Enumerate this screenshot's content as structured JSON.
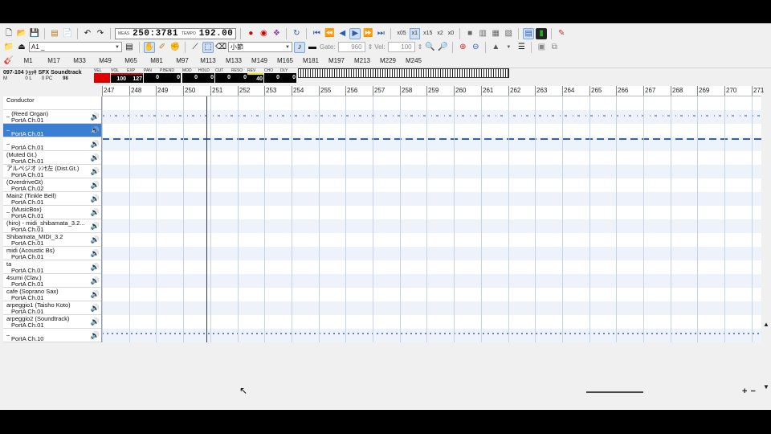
{
  "toolbar_main": {
    "buttons": [
      "new-icon",
      "open-icon",
      "save-icon",
      "export-icon",
      "properties-icon",
      "undo-icon",
      "redo-icon"
    ],
    "meas_label": "MEAS",
    "meas_value": "250:3781",
    "tempo_label": "TEMPO",
    "tempo_value": "192.00",
    "speeds": [
      "x05",
      "x1",
      "x15",
      "x2",
      "x0"
    ],
    "active_speed": "x1"
  },
  "toolbar_edit": {
    "track_combo": "A1 _",
    "snap_combo": "小節",
    "gate_label": "Gate:",
    "gate_value": "960",
    "vel_label": "Vel:",
    "vel_value": "100"
  },
  "marker_tabs": [
    "M1",
    "M17",
    "M33",
    "M49",
    "M65",
    "M81",
    "M97",
    "M113",
    "M133",
    "M149",
    "M165",
    "M181",
    "M197",
    "M213",
    "M229",
    "M245"
  ],
  "status": {
    "song_title": "097-104 ｼｮｯｷ SFX Soundtrack",
    "m_label": "M",
    "m_value": "0",
    "l_label": "L",
    "l_value": "0",
    "pc_label": "PC",
    "pc_value": "98",
    "controllers": [
      {
        "label": "VEL",
        "value": ""
      },
      {
        "label": "VOL",
        "value": "100"
      },
      {
        "label": "EXP",
        "value": "127"
      },
      {
        "label": "PAN",
        "value": "0"
      },
      {
        "label": "P.BEND",
        "value": "0"
      },
      {
        "label": "MOD",
        "value": "0"
      },
      {
        "label": "HOLD",
        "value": "0"
      },
      {
        "label": "CUT",
        "value": "0"
      },
      {
        "label": "RESO",
        "value": "0"
      },
      {
        "label": "REV",
        "value": "40"
      },
      {
        "label": "CHO",
        "value": "0"
      },
      {
        "label": "DLY",
        "value": "0"
      }
    ]
  },
  "ruler": [
    "247",
    "248",
    "249",
    "250",
    "251",
    "252",
    "253",
    "254",
    "255",
    "256",
    "257",
    "258",
    "259",
    "260",
    "261",
    "262",
    "263",
    "264",
    "265",
    "266",
    "267",
    "268",
    "269",
    "270",
    "271"
  ],
  "tracks": [
    {
      "name": "Conductor",
      "port": ""
    },
    {
      "name": "_ (Reed Organ)",
      "port": "PortA  Ch.01"
    },
    {
      "name": "_",
      "port": "PortA  Ch.01"
    },
    {
      "name": "_",
      "port": "PortA  Ch.01"
    },
    {
      "name": " (Muted Gt.)",
      "port": "PortA  Ch.01"
    },
    {
      "name": "アルペジオ ｼﾝｾ左 (Dist.Gt.)",
      "port": "PortA  Ch.01"
    },
    {
      "name": " (OverdriveGt)",
      "port": "PortA  Ch.02"
    },
    {
      "name": "Main2 (Tinkle Bell)",
      "port": "PortA  Ch.01"
    },
    {
      "name": "_ (MusicBox)",
      "port": "PortA  Ch.01"
    },
    {
      "name": " (hiro) - midi_shibamata_3.2...",
      "port": "PortA  Ch.01"
    },
    {
      "name": "Shibamata_MIDI_3.2",
      "port": "PortA  Ch.01"
    },
    {
      "name": "midi (Acoustic Bs)",
      "port": "PortA  Ch.01"
    },
    {
      "name": "ta",
      "port": "PortA  Ch.01"
    },
    {
      "name": "4sumi (Clav.)",
      "port": "PortA  Ch.01"
    },
    {
      "name": "cafe (Soprano Sax)",
      "port": "PortA  Ch.01"
    },
    {
      "name": "arpeggio1 (Taisho Koto)",
      "port": "PortA  Ch.01"
    },
    {
      "name": "arpeggio2 (Soundtrack)",
      "port": "PortA  Ch.01"
    },
    {
      "name": "_",
      "port": "PortA  Ch.10"
    }
  ],
  "selected_track": 2,
  "colors": {
    "selection": "#3b7fd4",
    "vel_bar": "#e00000",
    "grid_line": "#c5d3e6"
  }
}
